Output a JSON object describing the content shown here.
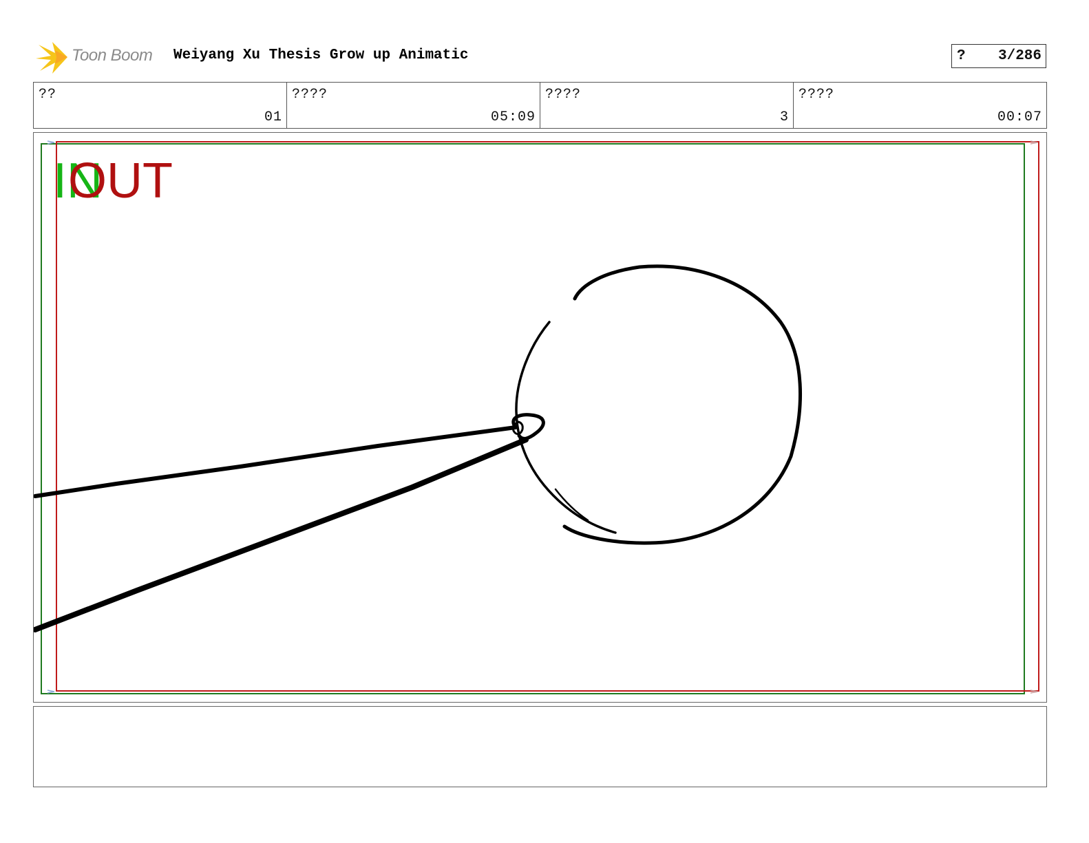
{
  "header": {
    "logo_text": "Toon Boom",
    "logo_icon": "toon-boom-starburst-icon",
    "title": "Weiyang Xu Thesis Grow up Animatic",
    "page_marker": "?",
    "page_number": "3/286"
  },
  "info": [
    {
      "label": "??",
      "value": "01"
    },
    {
      "label": "????",
      "value": "05:09"
    },
    {
      "label": "????",
      "value": "3"
    },
    {
      "label": "????",
      "value": "00:07"
    }
  ],
  "panel": {
    "in_label": "IN",
    "out_label": "OUT",
    "colors": {
      "in": "#16b516",
      "out": "#b01010",
      "frame_green": "#1f7a1f",
      "frame_red": "#c01a1a",
      "ink": "#000000"
    }
  },
  "notes": {
    "text": ""
  }
}
